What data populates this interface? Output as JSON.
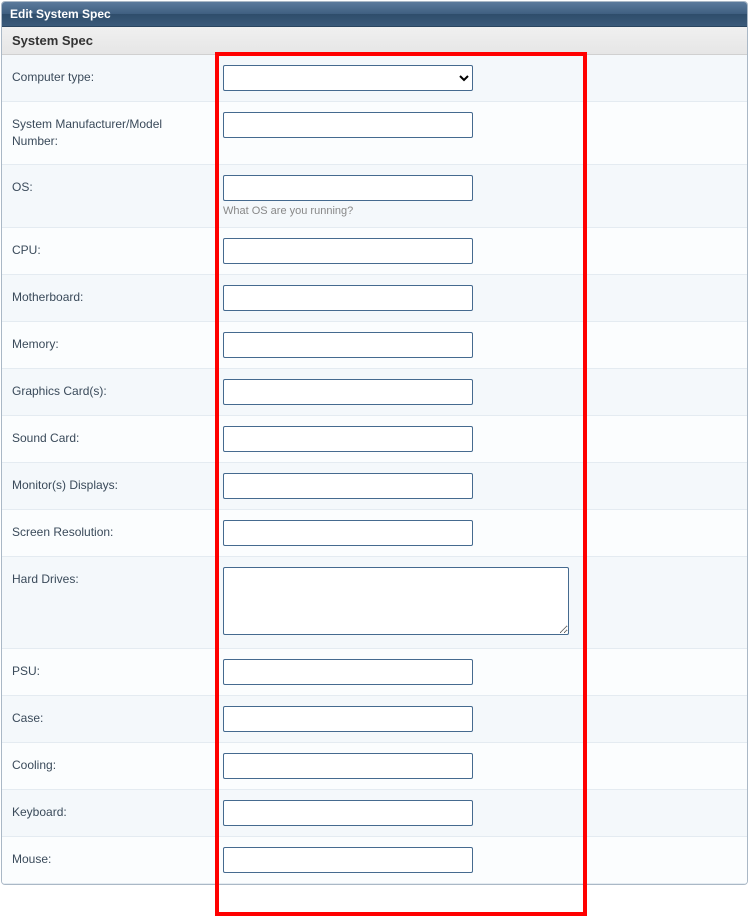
{
  "panel": {
    "title": "Edit System Spec",
    "subtitle": "System Spec"
  },
  "fields": {
    "computer_type": {
      "label": "Computer type:",
      "value": ""
    },
    "manufacturer": {
      "label": "System Manufacturer/Model Number:",
      "value": ""
    },
    "os": {
      "label": "OS:",
      "value": "",
      "hint": "What OS are you running?"
    },
    "cpu": {
      "label": "CPU:",
      "value": ""
    },
    "motherboard": {
      "label": "Motherboard:",
      "value": ""
    },
    "memory": {
      "label": "Memory:",
      "value": ""
    },
    "gpu": {
      "label": "Graphics Card(s):",
      "value": ""
    },
    "sound": {
      "label": "Sound Card:",
      "value": ""
    },
    "monitors": {
      "label": "Monitor(s) Displays:",
      "value": ""
    },
    "resolution": {
      "label": "Screen Resolution:",
      "value": ""
    },
    "drives": {
      "label": "Hard Drives:",
      "value": ""
    },
    "psu": {
      "label": "PSU:",
      "value": ""
    },
    "case": {
      "label": "Case:",
      "value": ""
    },
    "cooling": {
      "label": "Cooling:",
      "value": ""
    },
    "keyboard": {
      "label": "Keyboard:",
      "value": ""
    },
    "mouse": {
      "label": "Mouse:",
      "value": ""
    }
  }
}
